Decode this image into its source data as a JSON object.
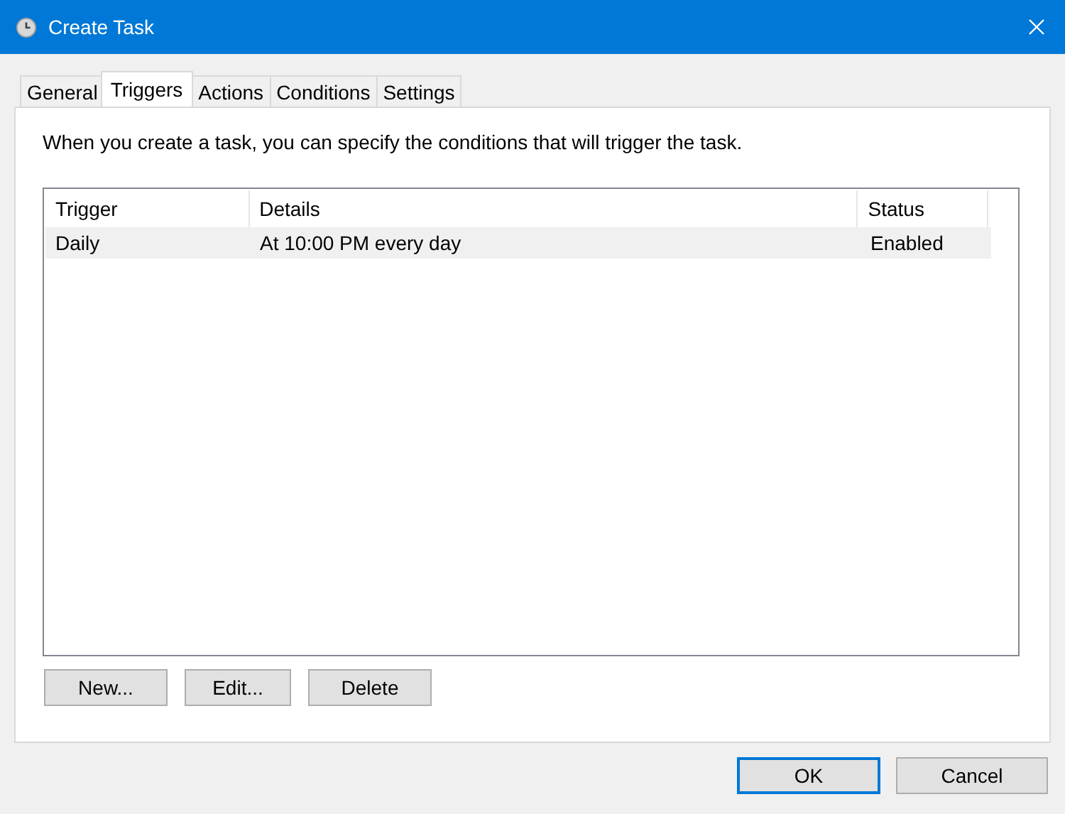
{
  "window": {
    "title": "Create Task"
  },
  "tabs": [
    {
      "label": "General",
      "selected": false
    },
    {
      "label": "Triggers",
      "selected": true
    },
    {
      "label": "Actions",
      "selected": false
    },
    {
      "label": "Conditions",
      "selected": false
    },
    {
      "label": "Settings",
      "selected": false
    }
  ],
  "description": "When you create a task, you can specify the conditions that will trigger the task.",
  "table": {
    "columns": [
      "Trigger",
      "Details",
      "Status"
    ],
    "rows": [
      {
        "cells": [
          "Daily",
          "At 10:00 PM every day",
          "Enabled"
        ],
        "selected": true
      }
    ]
  },
  "list_buttons": [
    "New...",
    "Edit...",
    "Delete"
  ],
  "dialog_buttons": [
    {
      "label": "OK",
      "default": true
    },
    {
      "label": "Cancel",
      "default": false
    }
  ]
}
